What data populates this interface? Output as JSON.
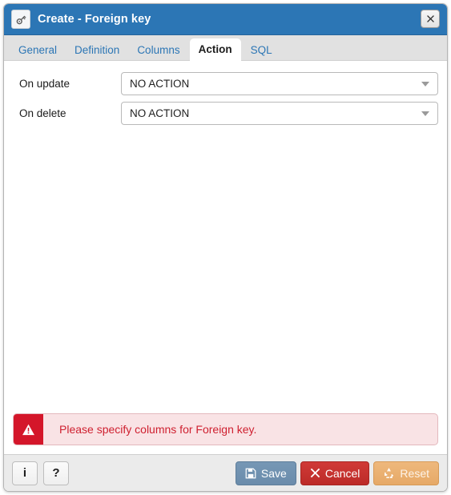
{
  "window": {
    "title": "Create - Foreign key",
    "icon": "key-icon",
    "close_label": "✖",
    "accent_color": "#2c76b5"
  },
  "tabs": [
    {
      "label": "General",
      "active": false
    },
    {
      "label": "Definition",
      "active": false
    },
    {
      "label": "Columns",
      "active": false
    },
    {
      "label": "Action",
      "active": true
    },
    {
      "label": "SQL",
      "active": false
    }
  ],
  "form": {
    "rows": [
      {
        "label": "On update",
        "value": "NO ACTION",
        "control": "select"
      },
      {
        "label": "On delete",
        "value": "NO ACTION",
        "control": "select"
      }
    ]
  },
  "alert": {
    "icon": "warning-triangle-icon",
    "message": "Please specify columns for Foreign key.",
    "icon_bg_color": "#d4162a",
    "bg_color": "#f9e3e5",
    "text_color": "#cf2030"
  },
  "footer": {
    "info_label": "i",
    "help_label": "?",
    "buttons": [
      {
        "label": "Save",
        "icon": "floppy-disk-icon",
        "color": "#6a8cab"
      },
      {
        "label": "Cancel",
        "icon": "x-mark-icon",
        "color": "#bc2b28"
      },
      {
        "label": "Reset",
        "icon": "recycle-icon",
        "color": "#e6a967"
      }
    ]
  }
}
